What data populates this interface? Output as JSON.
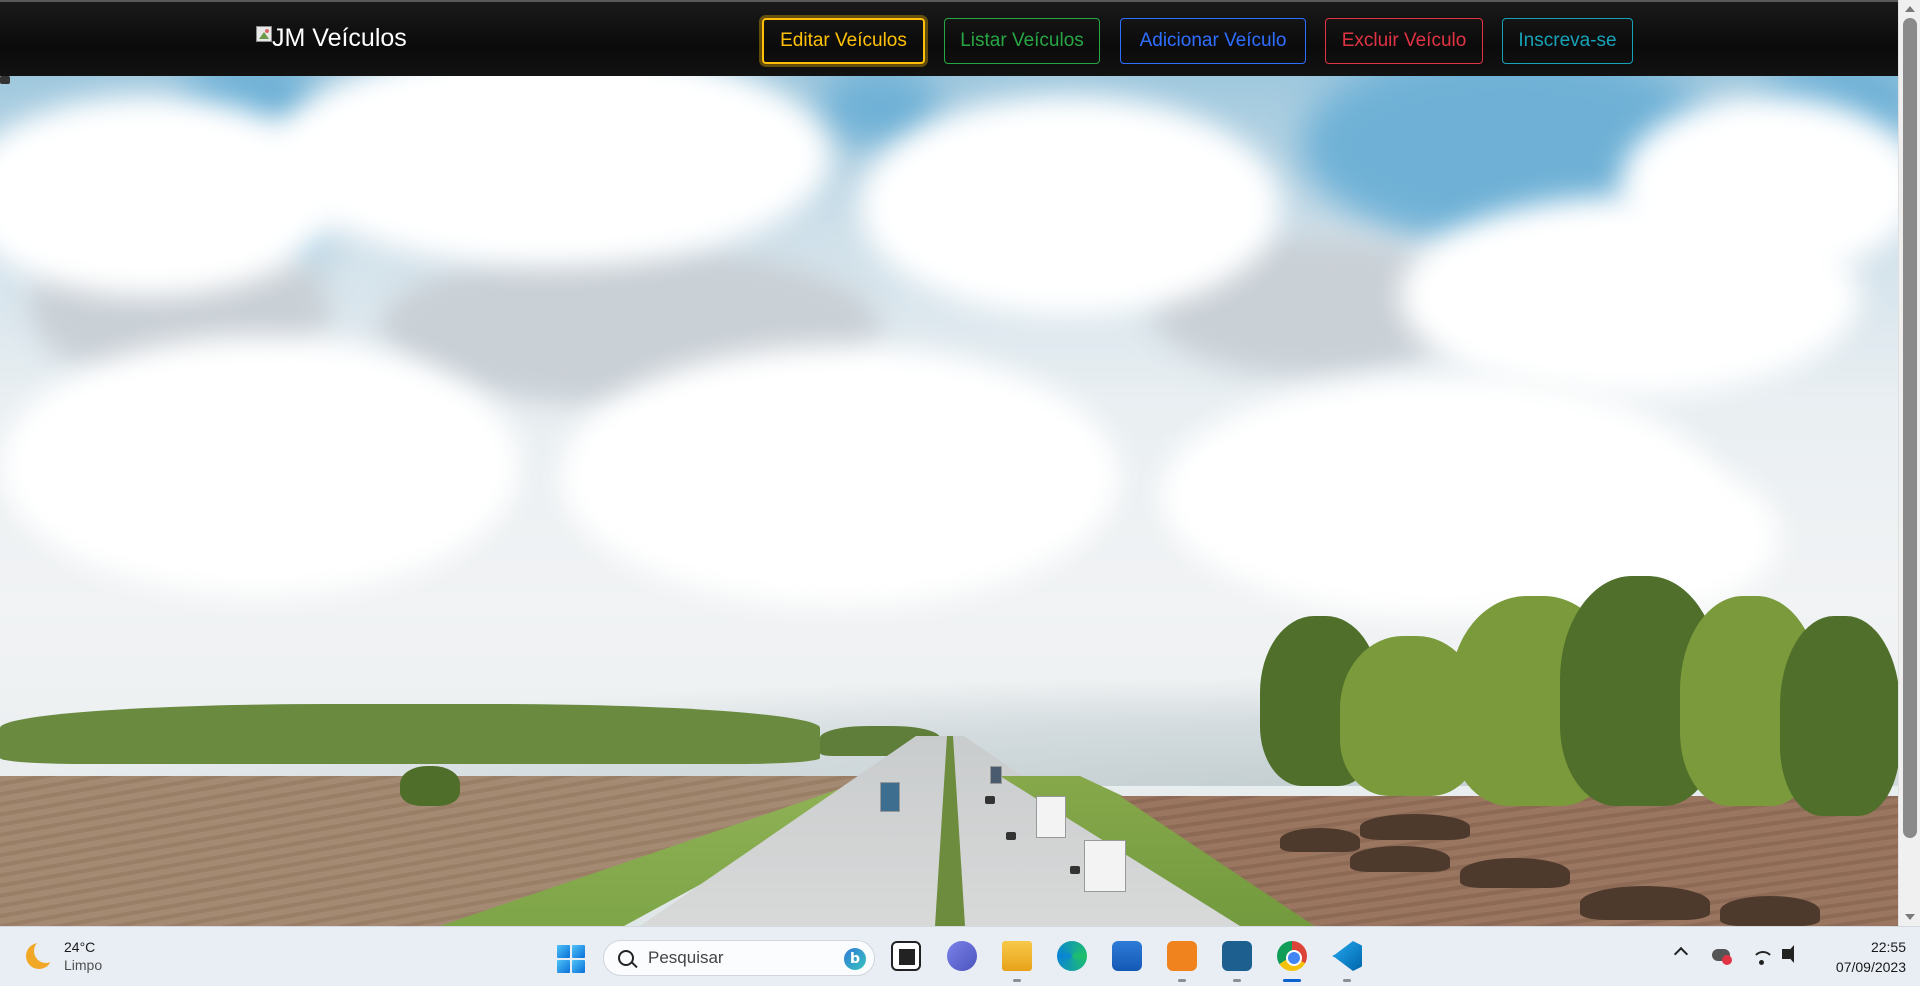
{
  "navbar": {
    "brand_text": "JM Veículos",
    "buttons": {
      "editar": "Editar Veículos",
      "listar": "Listar Veículos",
      "adicionar": "Adicionar Veículo",
      "excluir": "Excluir Veículo",
      "inscreva": "Inscreva-se"
    },
    "colors": {
      "editar": "#ffc107",
      "listar": "#28a745",
      "adicionar": "#2f6fff",
      "excluir": "#e03444",
      "inscreva": "#17a2b8"
    }
  },
  "taskbar": {
    "weather": {
      "temp": "24°C",
      "condition": "Limpo",
      "icon": "moon-icon"
    },
    "search": {
      "placeholder": "Pesquisar"
    },
    "apps": [
      "taskview-icon",
      "meet-icon",
      "explorer-icon",
      "edge-icon",
      "store-icon",
      "xampp-icon",
      "mysql-workbench-icon",
      "chrome-icon",
      "vscode-icon"
    ],
    "active_app": "chrome-icon",
    "clock": {
      "time": "22:55",
      "date": "07/09/2023"
    }
  }
}
